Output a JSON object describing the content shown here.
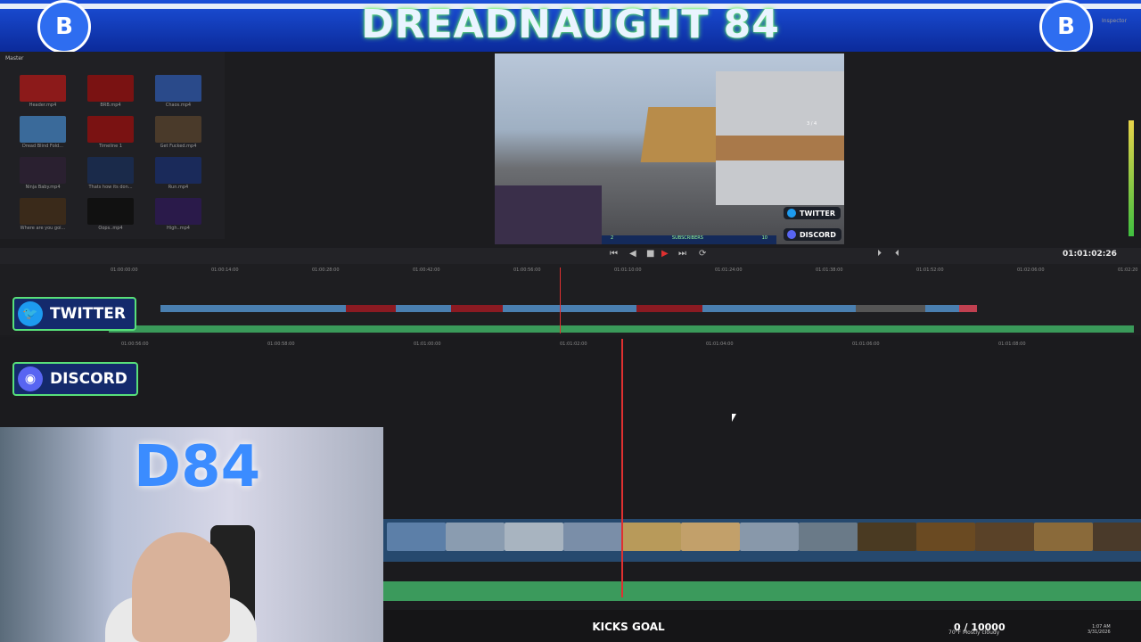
{
  "banner": {
    "title": "DREADNAUGHT 84"
  },
  "header": {
    "inspector_label": "Inspector"
  },
  "media_pool": {
    "folder": "Master",
    "clips": [
      {
        "name": "Header.mp4",
        "color": "#8c1a1a"
      },
      {
        "name": "BRB.mp4",
        "color": "#7a1212"
      },
      {
        "name": "Chaos.mp4",
        "color": "#2a4a8a"
      },
      {
        "name": "Dread Blind Fold...",
        "color": "#3a6a9a"
      },
      {
        "name": "Timeline 1",
        "color": "#7a1212"
      },
      {
        "name": "Get Fucked.mp4",
        "color": "#4a3a2a"
      },
      {
        "name": "Ninja Baby.mp4",
        "color": "#2a2030"
      },
      {
        "name": "Thats how its don...",
        "color": "#1a2a4a"
      },
      {
        "name": "Run.mp4",
        "color": "#1a2a5a"
      },
      {
        "name": "Where are you goi...",
        "color": "#3a2a1a"
      },
      {
        "name": "Oops..mp4",
        "color": "#111111"
      },
      {
        "name": "High..mp4",
        "color": "#2a1a4a"
      }
    ]
  },
  "viewer": {
    "overlay_twitter": "TWITTER",
    "overlay_discord": "DISCORD",
    "hud_subscribers": "SUBSCRIBERS",
    "hud_left": "2",
    "hud_right": "10",
    "hud_ammo": "3 / 4"
  },
  "transport": {
    "timecode": "01:01:02:26"
  },
  "upper_ruler": [
    "01:00:00:00",
    "01:00:14:00",
    "01:00:28:00",
    "01:00:42:00",
    "01:00:56:00",
    "01:01:10:00",
    "01:01:24:00",
    "01:01:38:00",
    "01:01:52:00",
    "01:02:06:00",
    "01:02:20"
  ],
  "lower_ruler": [
    "01:00:56:00",
    "01:00:58:00",
    "01:01:00:00",
    "01:01:02:00",
    "01:01:04:00",
    "01:01:06:00",
    "01:01:08:00"
  ],
  "social": {
    "twitter": "TWITTER",
    "discord": "DISCORD"
  },
  "bottom": {
    "now_playing": "KICKS GOAL",
    "counter": "0 / 10000",
    "weather": "70°F  Mostly cloudy",
    "time": "1:07 AM",
    "date": "3/31/2026"
  },
  "colors": {
    "accent": "#e03030",
    "video_track": "#26496e",
    "audio_track": "#3b9a5c",
    "badge_border": "#58e07a"
  }
}
